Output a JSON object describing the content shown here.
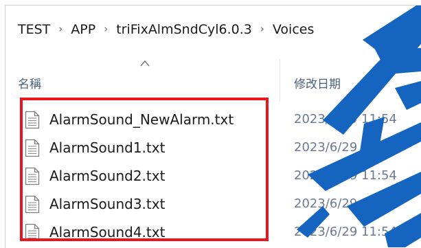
{
  "breadcrumb": [
    "TEST",
    "APP",
    "triFixAlmSndCyl6.0.3",
    "Voices"
  ],
  "breadcrumb_separator_icon": "chevron-right-icon",
  "columns": {
    "name": "名稱",
    "date_modified": "修改日期",
    "sort_icon": "sort-ascending-icon"
  },
  "files": [
    {
      "name": "AlarmSound_NewAlarm.txt",
      "modified": "2023/6/29 11:54",
      "icon": "text-file-icon"
    },
    {
      "name": "AlarmSound1.txt",
      "modified": "2023/6/29 11:54",
      "icon": "text-file-icon"
    },
    {
      "name": "AlarmSound2.txt",
      "modified": "2023/6/29 11:54",
      "icon": "text-file-icon"
    },
    {
      "name": "AlarmSound3.txt",
      "modified": "2023/6/29 11:54",
      "icon": "text-file-icon"
    },
    {
      "name": "AlarmSound4.txt",
      "modified": "2023/6/29 11:54",
      "icon": "text-file-icon"
    }
  ],
  "colors": {
    "selection_outline": "#e8141e",
    "header_text": "#4c607a",
    "date_text": "#6b7a93",
    "watermark": "#1565c0"
  }
}
